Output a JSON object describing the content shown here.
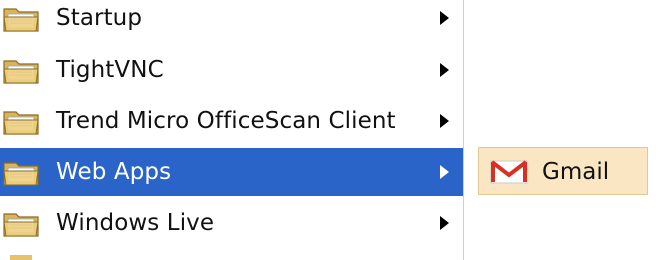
{
  "menu": {
    "items": [
      {
        "label": "Startup",
        "icon": "folder-icon",
        "active": false,
        "has_submenu": true
      },
      {
        "label": "TightVNC",
        "icon": "folder-icon",
        "active": false,
        "has_submenu": true
      },
      {
        "label": "Trend Micro OfficeScan Client",
        "icon": "folder-icon",
        "active": false,
        "has_submenu": true
      },
      {
        "label": "Web Apps",
        "icon": "folder-icon",
        "active": true,
        "has_submenu": true
      },
      {
        "label": "Windows Live",
        "icon": "folder-icon",
        "active": false,
        "has_submenu": true
      }
    ]
  },
  "submenu": {
    "items": [
      {
        "label": "Gmail",
        "icon": "gmail-icon"
      }
    ]
  },
  "colors": {
    "highlight": "#2b64c8",
    "submenu_hover": "#fbe6c4",
    "folder": "#e6c26a",
    "gmail_red": "#d93025"
  }
}
